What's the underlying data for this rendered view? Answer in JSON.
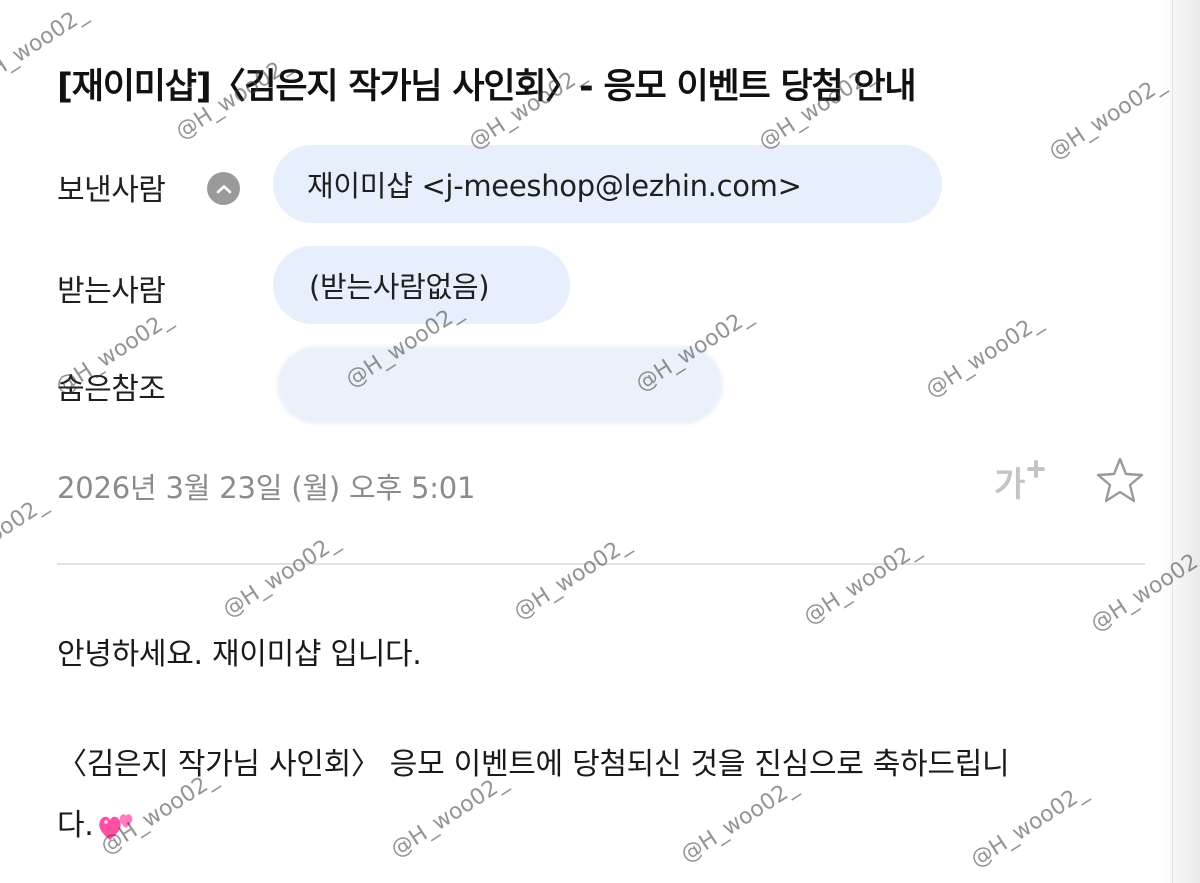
{
  "email": {
    "subject": "[재이미샵]〈김은지 작가님 사인회〉- 응모 이벤트 당첨 안내",
    "from": {
      "label": "보낸사람",
      "toggle_icon": "chevron-up-icon",
      "value": "재이미샵 <j-meeshop@lezhin.com>"
    },
    "to": {
      "label": "받는사람",
      "value": "(받는사람없음)"
    },
    "bcc": {
      "label": "숨은참조",
      "value": ""
    },
    "date": "2026년 3월 23일 (월) 오후 5:01",
    "actions": {
      "font_size_icon": "font-size-plus-icon",
      "font_size_glyph": "가",
      "star_icon": "star-outline-icon"
    },
    "body": {
      "line1": "안녕하세요. 재이미샵 입니다.",
      "line2": "〈김은지 작가님 사인회〉 응모 이벤트에 당첨되신 것을 진심으로 축하드립니",
      "line3": "다.",
      "emoji_icon": "two-hearts-icon"
    }
  },
  "watermark": {
    "text": "@H_woo02_"
  },
  "colors": {
    "chip_background": "#e6effb",
    "muted_text": "#8b8b8b",
    "icon_gray": "#9a9a9a",
    "heart_pink": "#ff4fa0"
  }
}
